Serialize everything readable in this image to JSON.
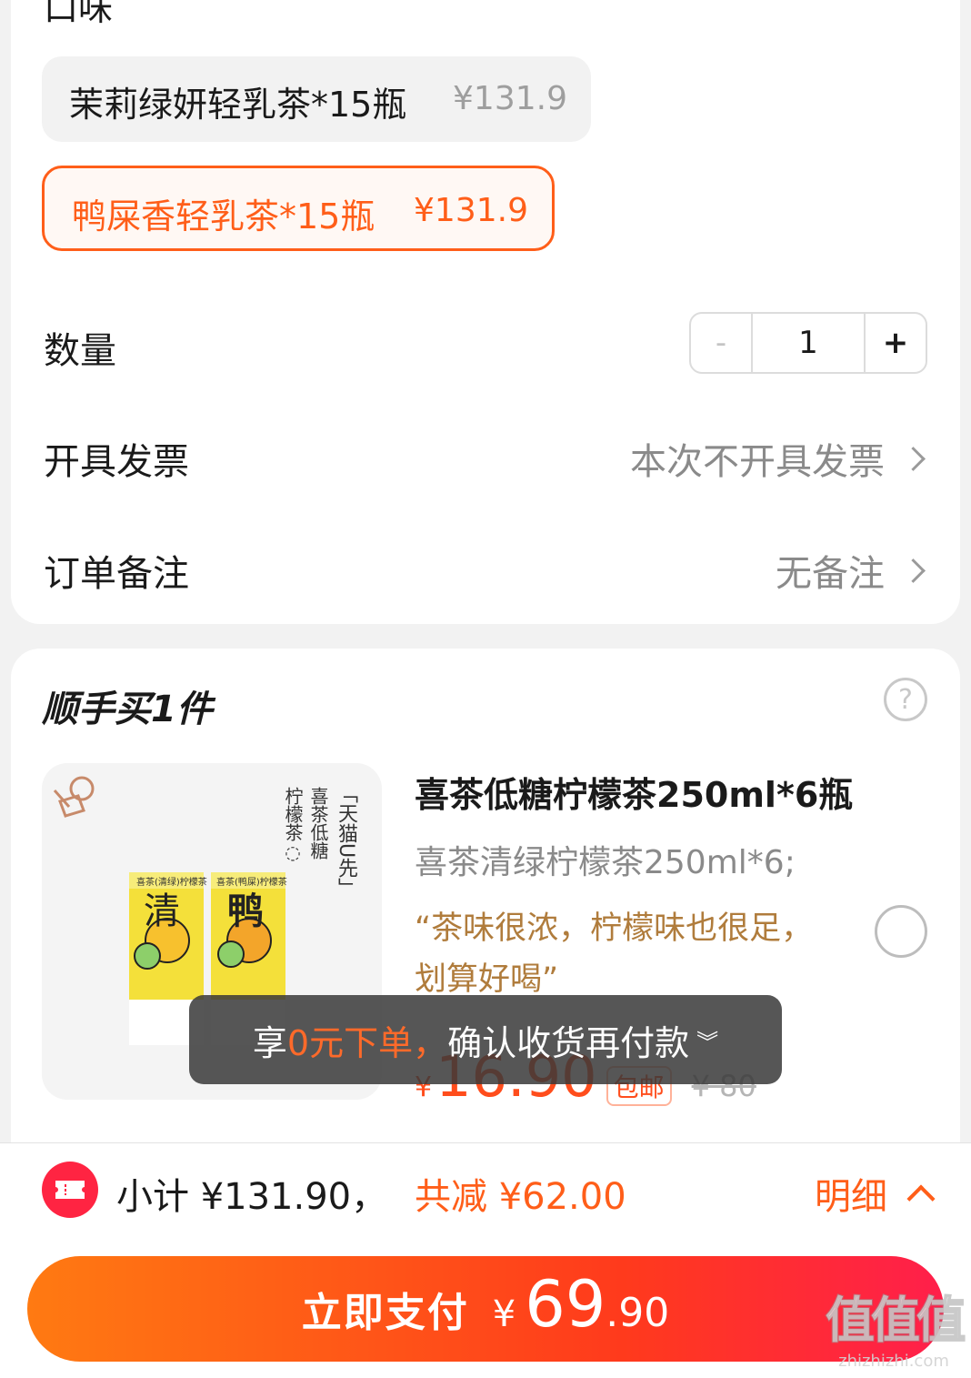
{
  "flavor_section": {
    "title": "口味",
    "options": [
      {
        "name": "茉莉绿妍轻乳茶*15瓶",
        "price": "¥131.9",
        "selected": false
      },
      {
        "name": "鸭屎香轻乳茶*15瓶",
        "price": "¥131.9",
        "selected": true
      }
    ]
  },
  "quantity": {
    "label": "数量",
    "minus": "-",
    "value": "1",
    "plus": "+"
  },
  "invoice": {
    "label": "开具发票",
    "value": "本次不开具发票"
  },
  "remark": {
    "label": "订单备注",
    "value": "无备注"
  },
  "addon": {
    "title": "顺手买1件",
    "help_icon": "question-circle-icon",
    "product": {
      "name": "喜茶低糖柠檬茶250ml*6瓶",
      "spec": "喜茶清绿柠檬茶250ml*6;",
      "review": "“茶味很浓，柠檬味也很足，划算好喝”",
      "price_currency": "¥",
      "price": "16.90",
      "shipping_tag": "包邮",
      "original_price": "¥ 80",
      "image": {
        "vertical_title_1": "柠檬茶◌",
        "vertical_title_2": "喜茶低糖",
        "vertical_title_3": "「天猫U先」",
        "box1_char": "清",
        "box2_char": "鸭",
        "box1_brand": "喜茶(清绿)柠檬茶",
        "box2_brand": "喜茶(鸭屎)柠檬茶"
      }
    }
  },
  "toast": {
    "prefix": "享",
    "highlight": "0元下单，",
    "suffix": "确认收货再付款"
  },
  "summary": {
    "coupon_icon": "coupon-ticket-icon",
    "subtotal": "小计 ¥131.90，",
    "discount": "共减 ¥62.00",
    "detail": "明细"
  },
  "pay": {
    "label": "立即支付",
    "currency": "¥",
    "integer": "69",
    "decimal": ".90"
  },
  "watermark": {
    "text": "值值值",
    "url": "zhizhizhi.com"
  },
  "colors": {
    "accent": "#ff5e19",
    "red": "#ff2442",
    "review": "#b07c3c",
    "toast_bg": "#383838"
  }
}
